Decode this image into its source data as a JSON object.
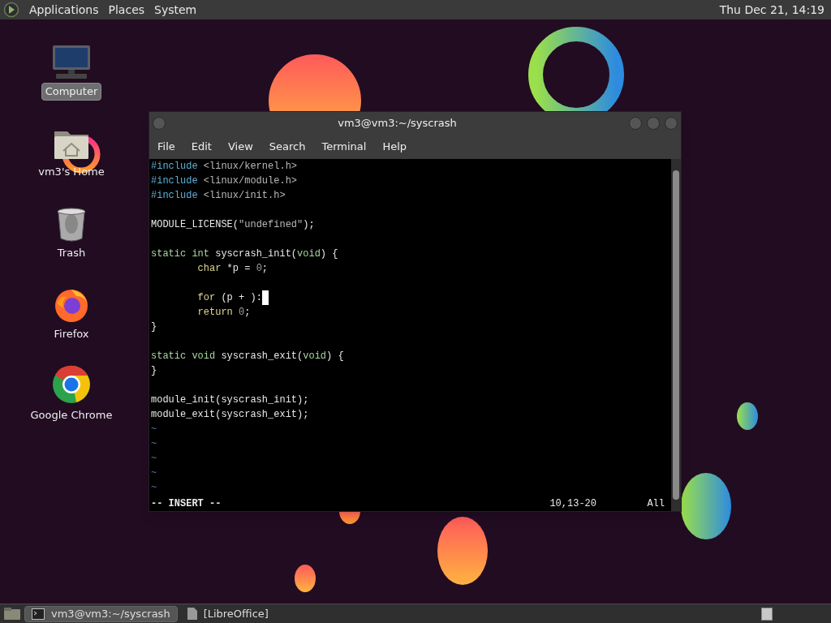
{
  "top_panel": {
    "menus": [
      "Applications",
      "Places",
      "System"
    ],
    "clock": "Thu Dec 21, 14:19"
  },
  "desktop_icons": [
    {
      "kind": "computer",
      "label": "Computer",
      "selected": true
    },
    {
      "kind": "home",
      "label": "vm3's Home",
      "selected": false
    },
    {
      "kind": "trash",
      "label": "Trash",
      "selected": false
    },
    {
      "kind": "firefox",
      "label": "Firefox",
      "selected": false
    },
    {
      "kind": "chrome",
      "label": "Google Chrome",
      "selected": false
    }
  ],
  "terminal": {
    "title": "vm3@vm3:~/syscrash",
    "menu": [
      "File",
      "Edit",
      "View",
      "Search",
      "Terminal",
      "Help"
    ],
    "lines": [
      {
        "kind": "code",
        "segments": [
          {
            "kind": "preproc",
            "text": "#include"
          },
          {
            "kind": "string",
            "text": " <linux/kernel.h>"
          }
        ]
      },
      {
        "kind": "code",
        "segments": [
          {
            "kind": "preproc",
            "text": "#include"
          },
          {
            "kind": "string",
            "text": " <linux/module.h>"
          }
        ]
      },
      {
        "kind": "code",
        "segments": [
          {
            "kind": "preproc",
            "text": "#include"
          },
          {
            "kind": "string",
            "text": " <linux/init.h>"
          }
        ]
      },
      {
        "kind": "blank"
      },
      {
        "kind": "code",
        "segments": [
          {
            "kind": "plain",
            "text": "MODULE_LICENSE("
          },
          {
            "kind": "string",
            "text": "\"undefined\""
          },
          {
            "kind": "plain",
            "text": ");"
          }
        ]
      },
      {
        "kind": "blank"
      },
      {
        "kind": "code",
        "segments": [
          {
            "kind": "type",
            "text": "static int"
          },
          {
            "kind": "plain",
            "text": " syscrash_init("
          },
          {
            "kind": "type",
            "text": "void"
          },
          {
            "kind": "plain",
            "text": ") {"
          }
        ]
      },
      {
        "kind": "code",
        "segments": [
          {
            "kind": "keyword",
            "text": "        char"
          },
          {
            "kind": "plain",
            "text": " *p = "
          },
          {
            "kind": "number",
            "text": "0"
          },
          {
            "kind": "plain",
            "text": ";"
          }
        ]
      },
      {
        "kind": "blank"
      },
      {
        "kind": "code",
        "cursor": true,
        "segments": [
          {
            "kind": "keyword",
            "text": "        for"
          },
          {
            "kind": "plain",
            "text": " (p + ):"
          }
        ]
      },
      {
        "kind": "code",
        "segments": [
          {
            "kind": "keyword",
            "text": "        return"
          },
          {
            "kind": "number",
            "text": " 0"
          },
          {
            "kind": "plain",
            "text": ";"
          }
        ]
      },
      {
        "kind": "code",
        "segments": [
          {
            "kind": "plain",
            "text": "}"
          }
        ]
      },
      {
        "kind": "blank"
      },
      {
        "kind": "code",
        "segments": [
          {
            "kind": "type",
            "text": "static void"
          },
          {
            "kind": "plain",
            "text": " syscrash_exit("
          },
          {
            "kind": "type",
            "text": "void"
          },
          {
            "kind": "plain",
            "text": ") {"
          }
        ]
      },
      {
        "kind": "code",
        "segments": [
          {
            "kind": "plain",
            "text": "}"
          }
        ]
      },
      {
        "kind": "blank"
      },
      {
        "kind": "code",
        "segments": [
          {
            "kind": "plain",
            "text": "module_init(syscrash_init);"
          }
        ]
      },
      {
        "kind": "code",
        "segments": [
          {
            "kind": "plain",
            "text": "module_exit(syscrash_exit);"
          }
        ]
      },
      {
        "kind": "tilde",
        "text": "~"
      },
      {
        "kind": "tilde",
        "text": "~"
      },
      {
        "kind": "tilde",
        "text": "~"
      },
      {
        "kind": "tilde",
        "text": "~"
      },
      {
        "kind": "tilde",
        "text": "~"
      }
    ],
    "status": {
      "mode": "-- INSERT --",
      "position": "10,13-20",
      "scroll": "All"
    }
  },
  "taskbar": {
    "tasks": [
      {
        "kind": "terminal",
        "label": "vm3@vm3:~/syscrash",
        "selected": true
      },
      {
        "kind": "document",
        "label": "[LibreOffice]",
        "selected": false
      }
    ]
  }
}
